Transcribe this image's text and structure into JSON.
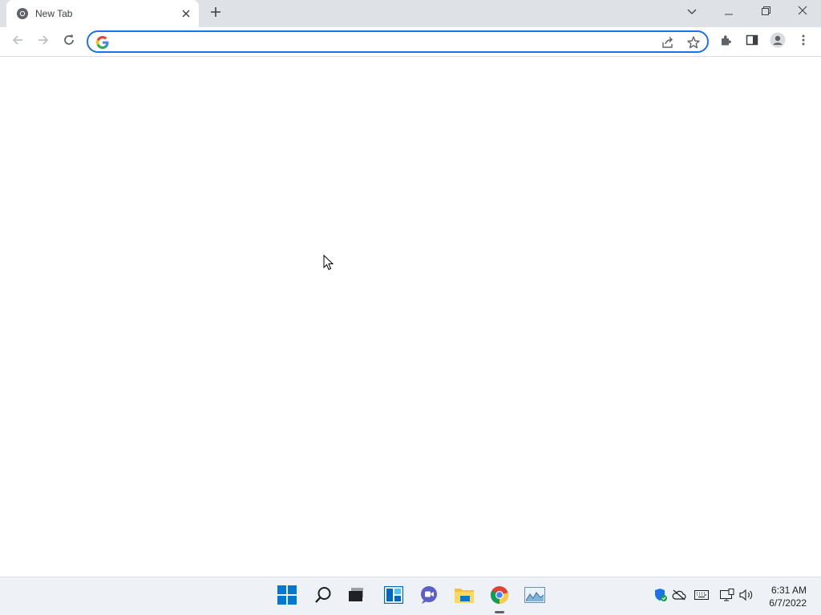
{
  "browser": {
    "tab": {
      "title": "New Tab",
      "favicon": "chrome-icon",
      "close_icon": "close-icon"
    },
    "new_tab_icon": "plus-icon",
    "window_controls": [
      "chevron-down-icon",
      "minimize-icon",
      "restore-icon",
      "close-icon"
    ],
    "toolbar": {
      "back_icon": "back-arrow-icon",
      "forward_icon": "forward-arrow-icon",
      "reload_icon": "reload-icon",
      "omnibox": {
        "value": "",
        "placeholder": "",
        "left_icon": "google-icon",
        "right_icons": [
          "share-icon",
          "star-icon"
        ]
      },
      "right_icons": [
        "extensions-icon",
        "side-panel-icon",
        "profile-icon",
        "menu-icon"
      ]
    }
  },
  "taskbar": {
    "apps": [
      "windows-start-icon",
      "search-icon",
      "task-view-icon",
      "widgets-icon",
      "chat-icon",
      "file-explorer-icon",
      "chrome-icon",
      "photos-icon"
    ],
    "active_app": "chrome-icon",
    "tray_icons": [
      "security-icon",
      "onedrive-icon",
      "keyboard-icon",
      "network-icon",
      "volume-icon"
    ],
    "time": "6:31 AM",
    "date": "6/7/2022"
  },
  "colors": {
    "tabstrip_bg": "#dee1e6",
    "accent": "#1a73e8",
    "taskbar_bg": "#eef1f5"
  }
}
